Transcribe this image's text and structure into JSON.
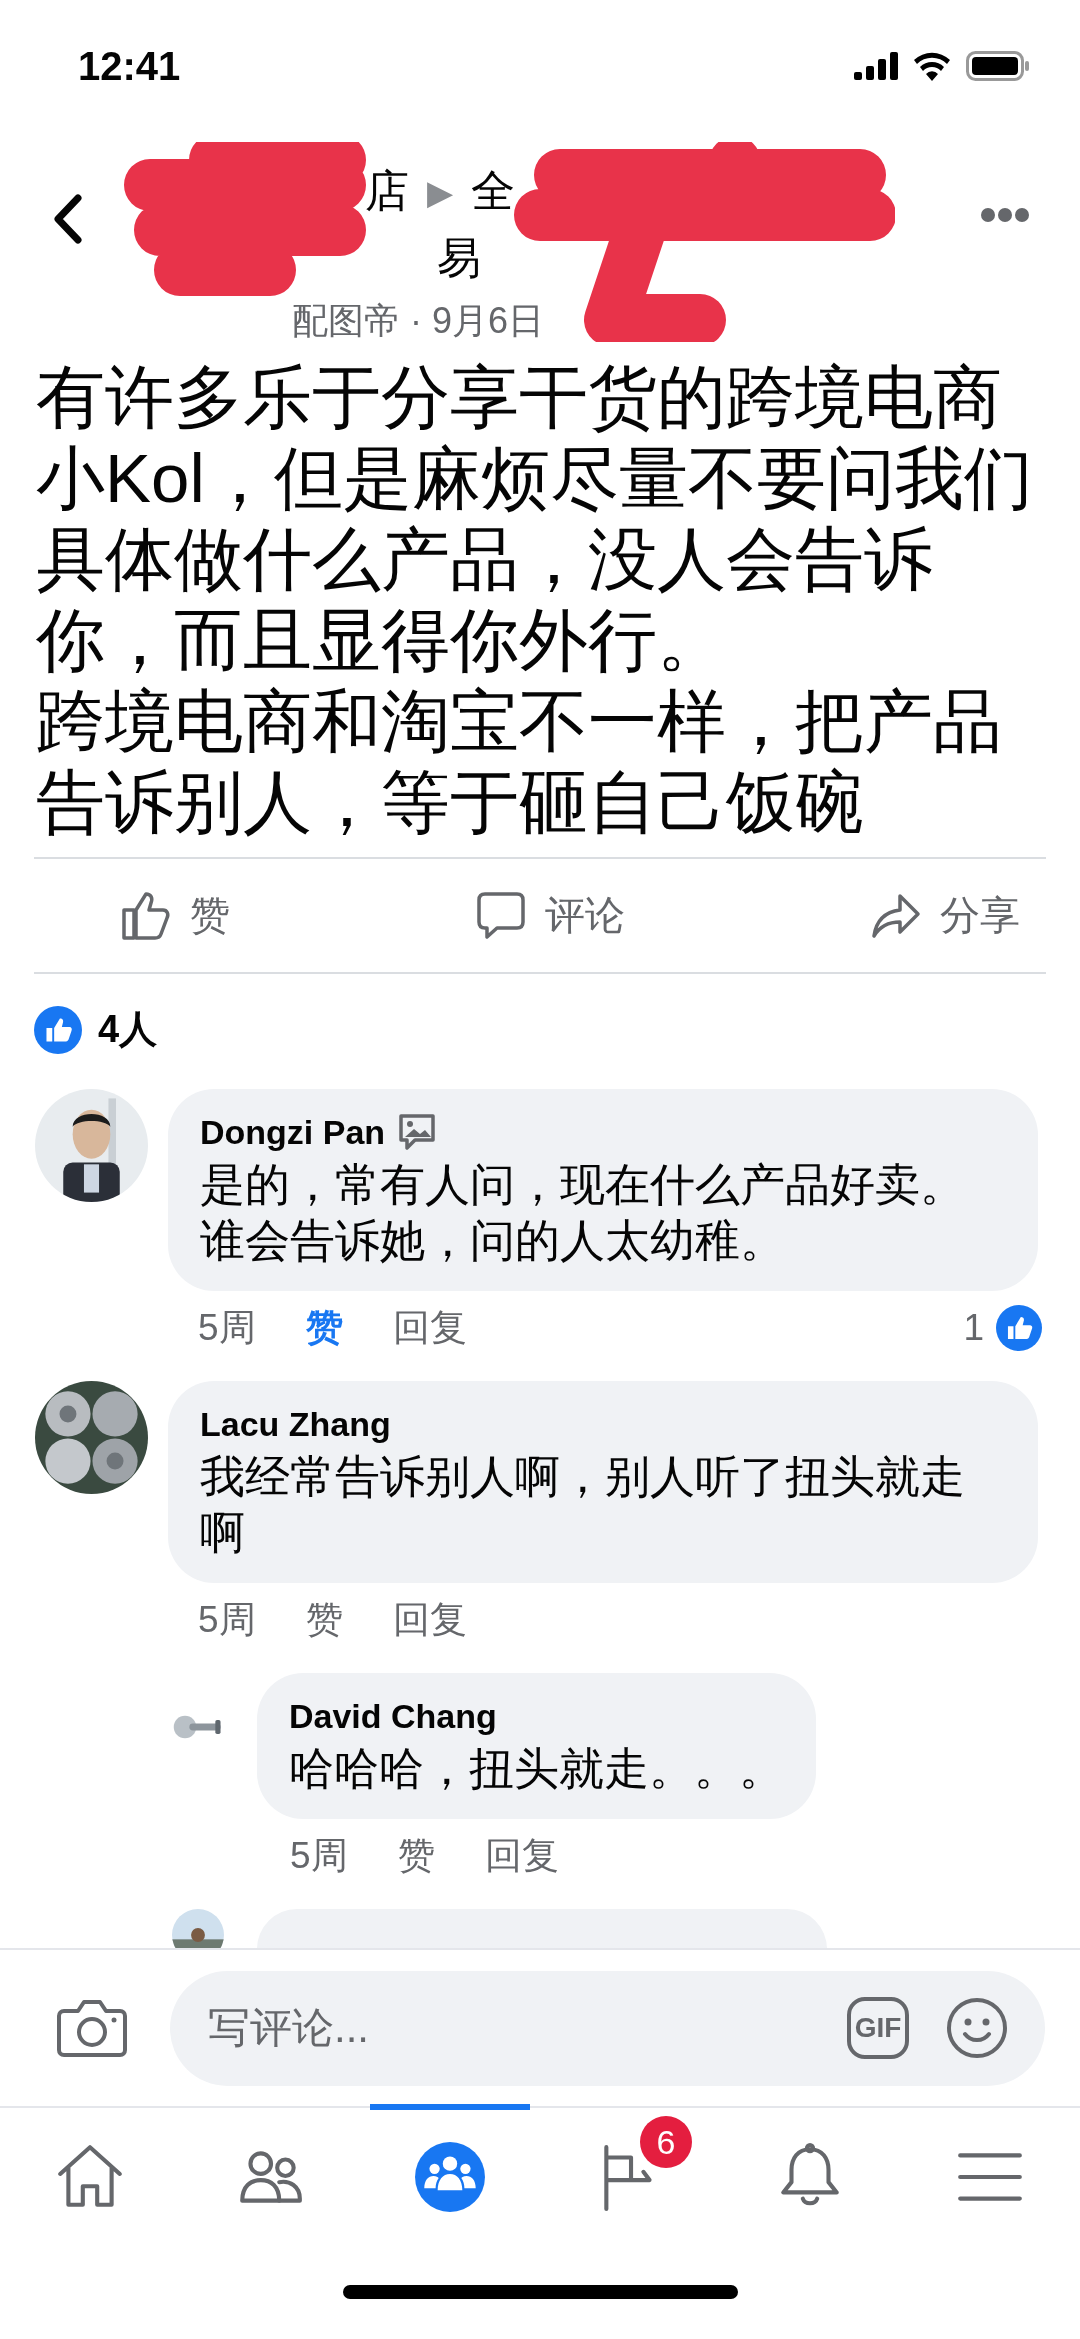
{
  "status_bar": {
    "time": "12:41"
  },
  "header": {
    "title_parts": [
      "店",
      "▶",
      "全"
    ],
    "subtitle_part": "易",
    "meta": "配图帝 · 9月6日"
  },
  "post": {
    "paragraphs": [
      "有许多乐于分享干货的跨境电商小Kol，但是麻烦尽量不要问我们具体做什么产品，没人会告诉你，而且显得你外行。",
      "跨境电商和淘宝不一样，把产品告诉别人，等于砸自己饭碗"
    ]
  },
  "actions": [
    {
      "kind": "like",
      "label": "赞"
    },
    {
      "kind": "comment",
      "label": "评论"
    },
    {
      "kind": "share",
      "label": "分享"
    }
  ],
  "reactions": {
    "count": "4人"
  },
  "comments": [
    {
      "kind": "comment",
      "name": "Dongzi Pan",
      "has_photo_badge": true,
      "text": "是的，常有人问，现在什么产品好卖。谁会告诉她，问的人太幼稚。",
      "time": "5周",
      "like": "赞",
      "liked": true,
      "reply": "回复",
      "reaction_count": "1"
    },
    {
      "kind": "comment",
      "name": "Lacu Zhang",
      "has_photo_badge": false,
      "text": "我经常告诉别人啊，别人听了扭头就走啊",
      "time": "5周",
      "like": "赞",
      "liked": false,
      "reply": "回复",
      "children": [
        {
          "kind": "comment",
          "name": "David Chang",
          "has_photo_badge": false,
          "text": "哈哈哈，扭头就走。。。",
          "time": "5周",
          "like": "赞",
          "liked": false,
          "reply": "回复"
        },
        {
          "kind": "partial"
        }
      ]
    }
  ],
  "composer": {
    "placeholder": "写评论...",
    "gif_label": "GIF"
  },
  "nav": [
    {
      "kind": "home",
      "selected": false
    },
    {
      "kind": "friends",
      "selected": false
    },
    {
      "kind": "groups",
      "selected": true
    },
    {
      "kind": "pages",
      "selected": false,
      "badge": "6"
    },
    {
      "kind": "notifications",
      "selected": false
    },
    {
      "kind": "menu",
      "selected": false
    }
  ]
}
